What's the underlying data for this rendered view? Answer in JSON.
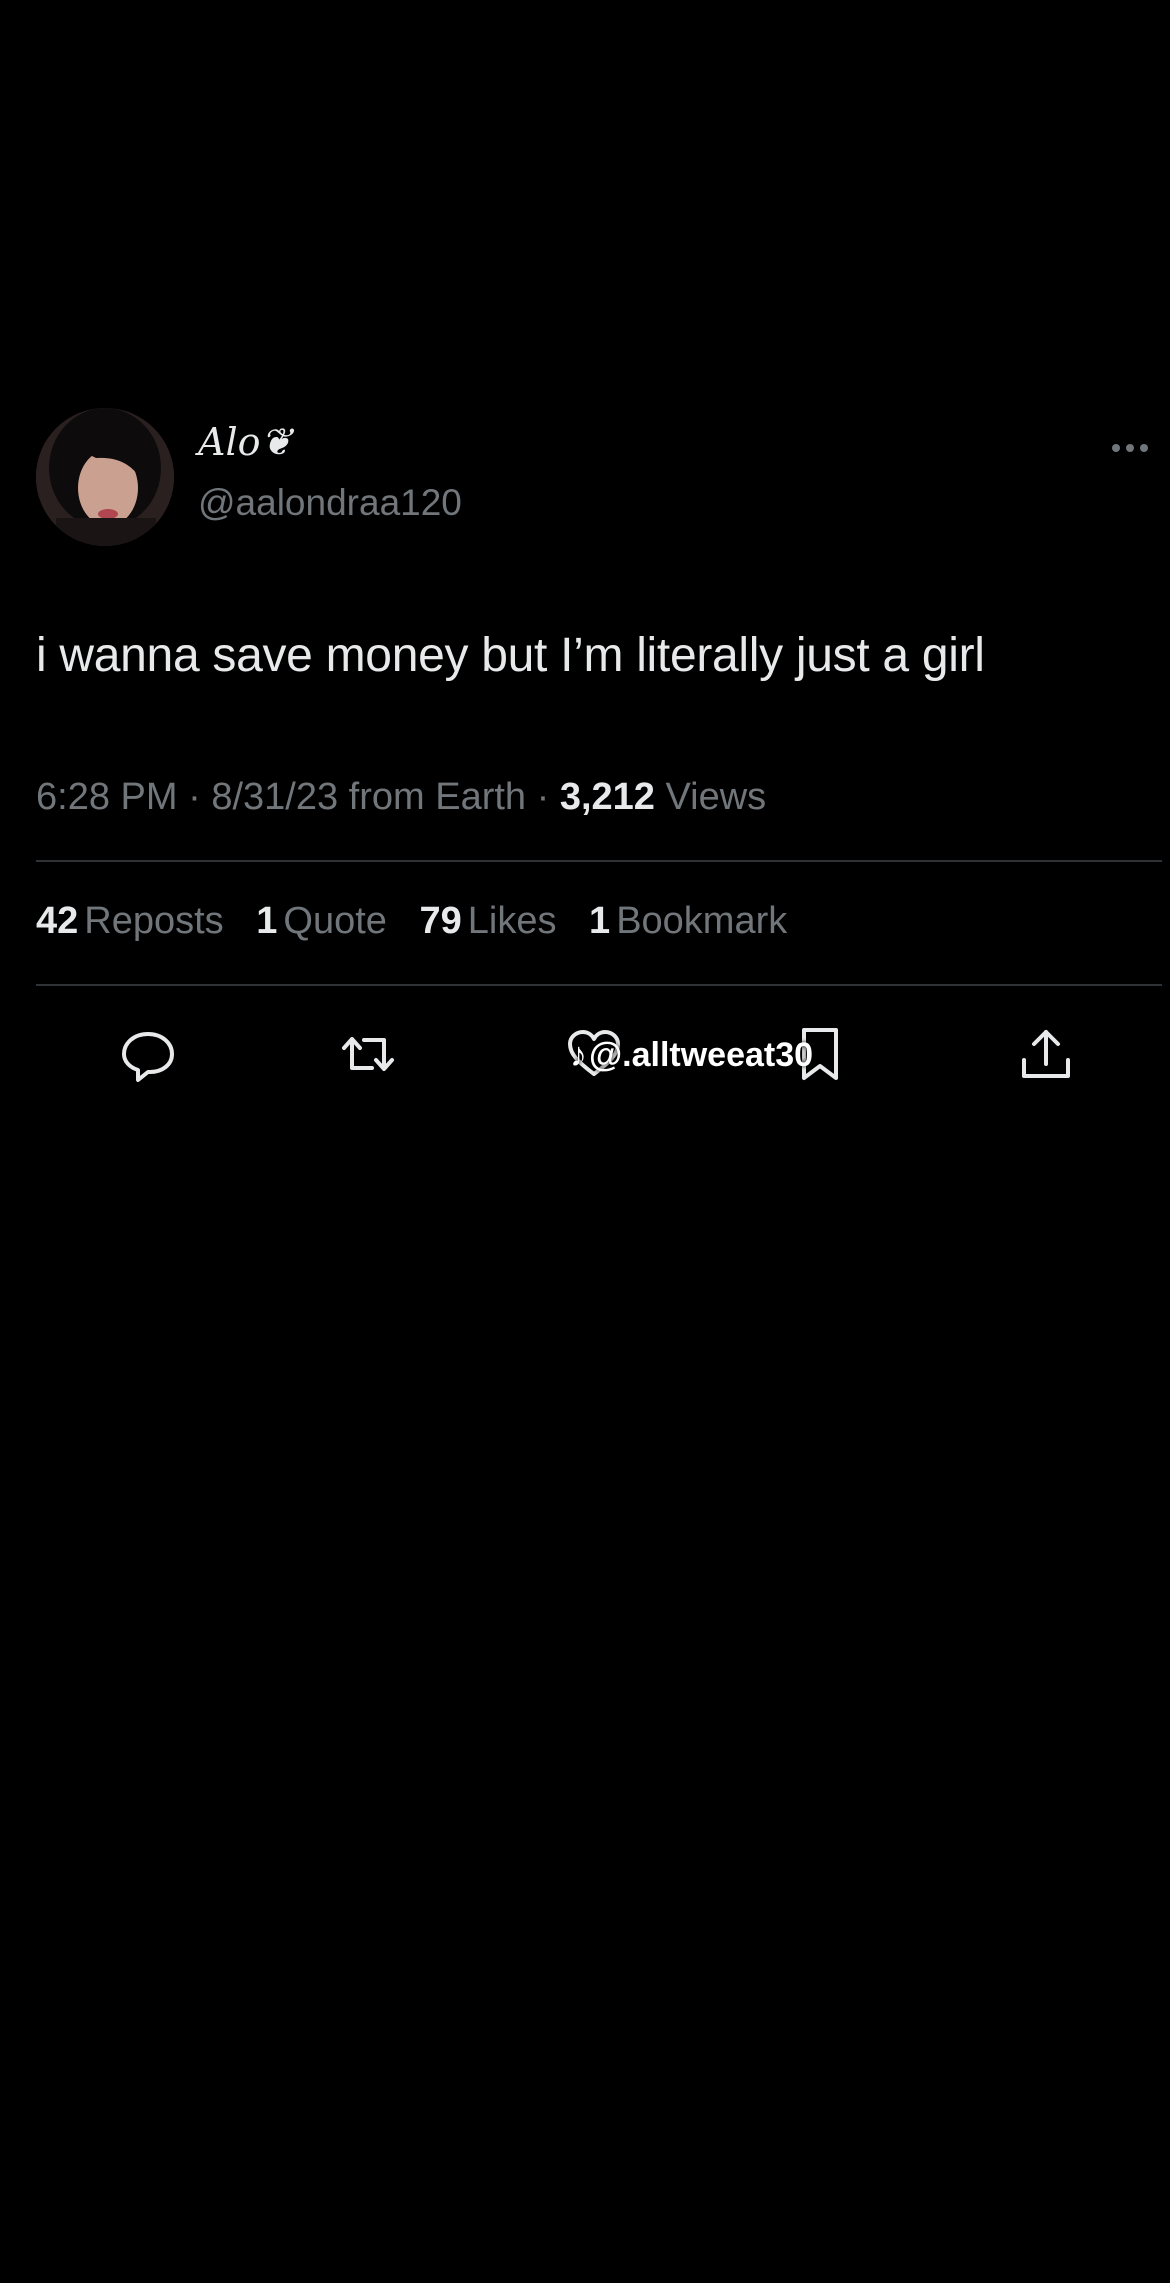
{
  "tweet": {
    "display_name": "Alo❦",
    "handle": "@aalondraa120",
    "text": "i wanna save money but I’m literally just a girl",
    "meta": {
      "time": "6:28 PM",
      "date": "8/31/23",
      "source": "from Earth",
      "views_count": "3,212",
      "views_label": "Views"
    },
    "stats": {
      "reposts": {
        "count": "42",
        "label": "Reposts"
      },
      "quotes": {
        "count": "1",
        "label": "Quote"
      },
      "likes": {
        "count": "79",
        "label": "Likes"
      },
      "bookmarks": {
        "count": "1",
        "label": "Bookmark"
      }
    },
    "actions": [
      "reply-icon",
      "repost-icon",
      "like-icon",
      "bookmark-icon",
      "share-icon"
    ]
  },
  "watermark": {
    "icon": "tiktok-icon",
    "text": "@.alltweeat30"
  },
  "colors": {
    "background": "#000000",
    "primary_text": "#e7e9ea",
    "secondary_text": "#71767b",
    "divider": "#2f3336"
  }
}
